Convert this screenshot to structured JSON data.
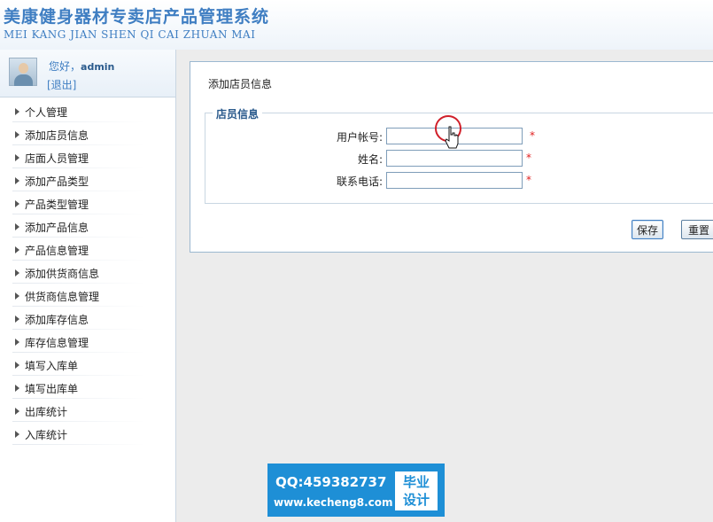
{
  "header": {
    "title": "美康健身器材专卖店产品管理系统",
    "subtitle": "MEI KANG JIAN SHEN QI CAI ZHUAN MAI"
  },
  "user": {
    "greeting": "您好，",
    "name": "admin",
    "logout": "[退出]"
  },
  "sidebar": {
    "items": [
      {
        "label": "个人管理"
      },
      {
        "label": "添加店员信息"
      },
      {
        "label": "店面人员管理"
      },
      {
        "label": "添加产品类型"
      },
      {
        "label": "产品类型管理"
      },
      {
        "label": "添加产品信息"
      },
      {
        "label": "产品信息管理"
      },
      {
        "label": "添加供货商信息"
      },
      {
        "label": "供货商信息管理"
      },
      {
        "label": "添加库存信息"
      },
      {
        "label": "库存信息管理"
      },
      {
        "label": "填写入库单"
      },
      {
        "label": "填写出库单"
      },
      {
        "label": "出库统计"
      },
      {
        "label": "入库统计"
      }
    ]
  },
  "form": {
    "title": "添加店员信息",
    "legend": "店员信息",
    "fields": [
      {
        "label": "用户帐号:",
        "value": "",
        "required": "*"
      },
      {
        "label": "姓名:",
        "value": "",
        "required": "*"
      },
      {
        "label": "联系电话:",
        "value": "",
        "required": "*"
      }
    ],
    "save_label": "保存",
    "reset_label": "重置"
  },
  "watermark": {
    "qq": "QQ:459382737",
    "url": "www.kecheng8.com",
    "badge_line1": "毕业",
    "badge_line2": "设计"
  },
  "colors": {
    "accent": "#3f7ec2",
    "required": "#e02020",
    "watermark": "#1e8fd6"
  }
}
